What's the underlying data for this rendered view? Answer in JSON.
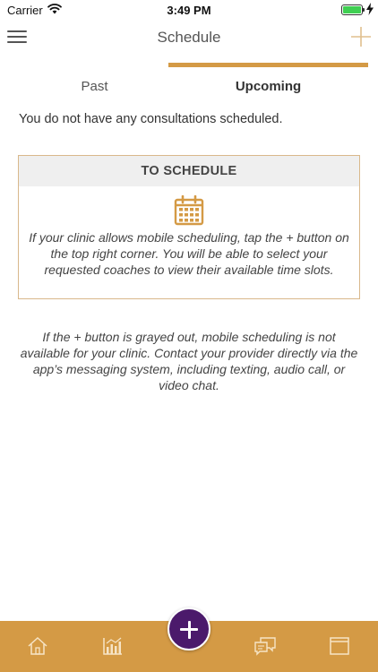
{
  "status_bar": {
    "carrier": "Carrier",
    "time": "3:49 PM",
    "battery_percent": 100,
    "battery_color": "#3fcf52"
  },
  "nav": {
    "title": "Schedule",
    "menu_icon": "hamburger-icon",
    "add_icon": "plus-icon"
  },
  "tabs": [
    {
      "label": "Past",
      "selected": false
    },
    {
      "label": "Upcoming",
      "selected": true
    }
  ],
  "empty_message": "You do not have any consultations scheduled.",
  "card": {
    "header": "TO SCHEDULE",
    "icon": "calendar-icon",
    "body": "If your clinic allows mobile scheduling, tap the + button on the top right corner. You will be able to select your requested coaches to view their available time slots."
  },
  "note": "If the + button is grayed out, mobile scheduling is not available for your clinic. Contact your provider directly via the app’s messaging system, including texting, audio call, or video chat.",
  "tab_bar": {
    "items": [
      "home-icon",
      "chart-icon",
      "add-icon",
      "chat-icon",
      "window-icon"
    ]
  },
  "colors": {
    "accent": "#d49a45",
    "fab": "#4b1a6b",
    "card_border": "#d9b88b",
    "card_header_bg": "#efefef"
  }
}
